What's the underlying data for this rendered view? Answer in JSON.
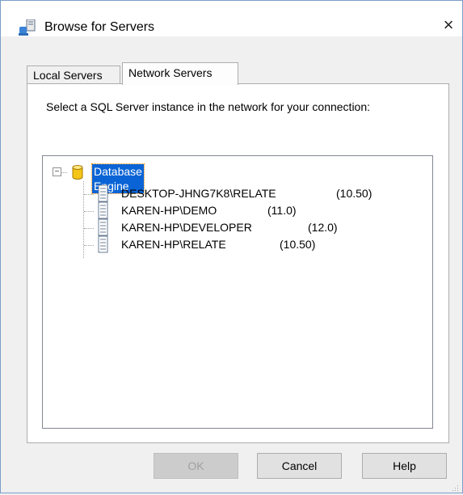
{
  "window": {
    "title": "Browse for Servers",
    "close_glyph": "×"
  },
  "tabs": [
    {
      "label": "Local Servers",
      "active": false
    },
    {
      "label": "Network Servers",
      "active": true
    }
  ],
  "instructions": "Select a SQL Server instance in the network for your connection:",
  "tree": {
    "expander_glyph": "−",
    "root": {
      "label": "Database Engine",
      "icon": "database-icon",
      "expanded": true
    },
    "servers": [
      {
        "name": "DESKTOP-JHNG7K8\\RELATE",
        "version": "(10.50)",
        "icon": "server-icon"
      },
      {
        "name": "KAREN-HP\\DEMO",
        "version": "(11.0)",
        "icon": "server-icon"
      },
      {
        "name": "KAREN-HP\\DEVELOPER",
        "version": "(12.0)",
        "icon": "server-icon"
      },
      {
        "name": "KAREN-HP\\RELATE",
        "version": "(10.50)",
        "icon": "server-icon"
      }
    ]
  },
  "buttons": {
    "ok": {
      "label": "OK",
      "enabled": false
    },
    "cancel": {
      "label": "Cancel",
      "enabled": true
    },
    "help": {
      "label": "Help",
      "enabled": true
    }
  },
  "colors": {
    "selection": "#0a64d6",
    "db_yellow": "#f5c518"
  }
}
